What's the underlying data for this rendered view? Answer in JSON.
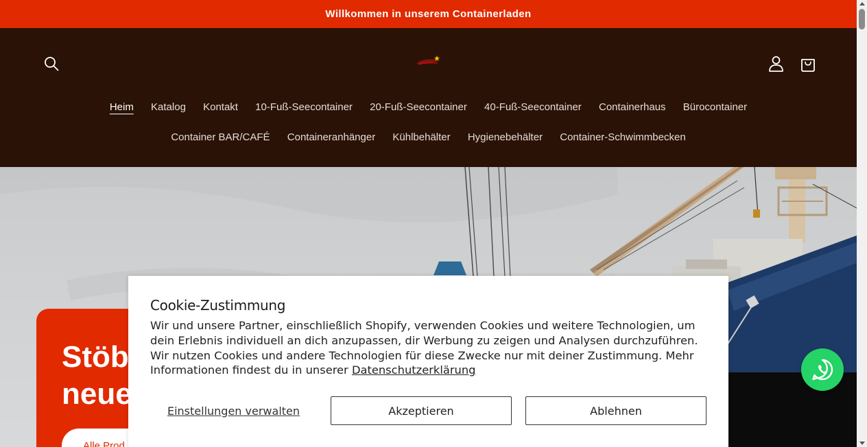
{
  "announcement": {
    "text": "Willkommen in unserem Containerladen"
  },
  "header": {
    "nav_row1": [
      {
        "label": "Heim",
        "active": true
      },
      {
        "label": "Katalog"
      },
      {
        "label": "Kontakt"
      },
      {
        "label": "10-Fuß-Seecontainer"
      },
      {
        "label": "20-Fuß-Seecontainer"
      },
      {
        "label": "40-Fuß-Seecontainer"
      },
      {
        "label": "Containerhaus"
      },
      {
        "label": "Bürocontainer"
      }
    ],
    "nav_row2": [
      {
        "label": "Container BAR/CAFÉ"
      },
      {
        "label": "Containeranhänger"
      },
      {
        "label": "Kühlbehälter"
      },
      {
        "label": "Hygienebehälter"
      },
      {
        "label": "Container-Schwimmbecken"
      }
    ]
  },
  "hero": {
    "title_line1": "Stöb",
    "title_line2": "neue",
    "cta_label": "Alle Prod"
  },
  "cookie": {
    "heading": "Cookie-Zustimmung",
    "body_text": "Wir und unsere Partner, einschließlich Shopify, verwenden Cookies und weitere Technologien, um dein Erlebnis individuell an dich anzupassen, dir Werbung zu zeigen und Analysen durchzuführen. Wir nutzen Cookies und andere Technologien für diese Zwecke nur mit deiner Zustimmung. Mehr Informationen findest du in unserer",
    "privacy_link": "Datenschutzerklärung",
    "manage_label": "Einstellungen verwalten",
    "accept_label": "Akzeptieren",
    "decline_label": "Ablehnen"
  },
  "colors": {
    "brand_red": "#e12a00",
    "header_brown": "#2a1206",
    "whatsapp_green": "#25d366"
  },
  "icons": [
    "search-icon",
    "logo",
    "account-icon",
    "cart-icon",
    "whatsapp-icon"
  ]
}
